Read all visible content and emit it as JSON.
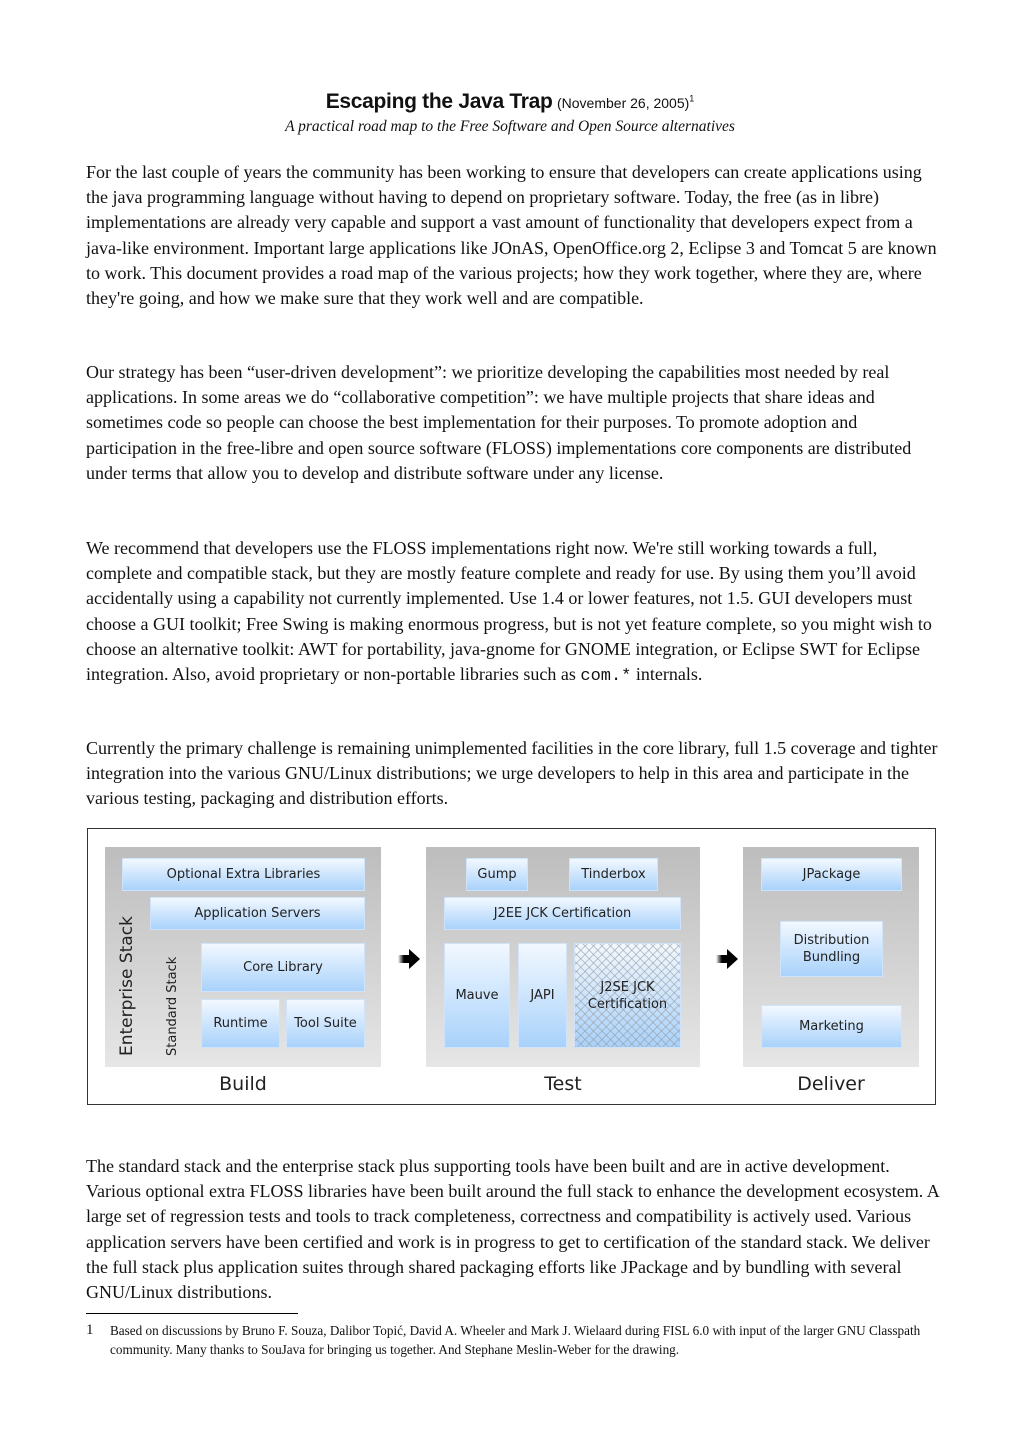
{
  "header": {
    "title": "Escaping the Java Trap",
    "date": "(November 26, 2005)",
    "footnote_ref": "1",
    "subtitle": "A practical road map to the Free Software and Open Source alternatives"
  },
  "paragraphs": [
    "For the last couple of years the community has been working to ensure that developers can create applications using the java programming language without having to depend on proprietary software. Today, the free (as in libre) implementations are already very capable and support a vast amount of functionality that developers expect from a java-like environment. Important large applications like JOnAS, OpenOffice.org 2, Eclipse 3 and Tomcat 5 are known to work. This document provides a road map of the various projects; how they work together, where they are, where they're going, and how we make sure that they work well and are compatible.",
    "Our strategy has been “user-driven development”: we prioritize developing the capabilities most needed by real applications. In some areas we do “collaborative competition”: we have multiple projects that share ideas and sometimes code so people can choose the best implementation for their purposes.  To promote adoption and participation in the free-libre and open source software (FLOSS) implementations core components are distributed under terms that allow you to develop and distribute software under any license.",
    "Currently the primary challenge is remaining unimplemented facilities in the core library, full 1.5 coverage and tighter integration into the various GNU/Linux distributions; we urge developers to help in this area and participate in the various testing, packaging and distribution efforts.",
    "The standard stack and the enterprise stack plus supporting tools have been built and are in active development. Various optional extra FLOSS libraries have been built around the full stack to enhance the development ecosystem. A large set of regression tests and tools to track completeness, correctness and compatibility is actively used. Various application servers have been certified and work is in progress to get to certification of the standard stack. We deliver the full stack plus application suites through shared packaging efforts like JPackage and by bundling with several GNU/Linux distributions."
  ],
  "paragraph3": {
    "before_code": "We recommend that developers use the FLOSS implementations right now. We're still working towards a full, complete and compatible stack, but they are mostly feature complete and ready for use. By using them you’ll avoid accidentally using a capability not currently implemented.  Use 1.4 or lower features, not 1.5. GUI developers must choose a GUI toolkit; Free Swing is making enormous progress, but is not yet feature complete, so you might wish to choose an alternative toolkit: AWT for portability, java-gnome for GNOME integration, or Eclipse SWT for Eclipse integration. Also, avoid proprietary or non-portable libraries such as ",
    "code": "com.*",
    "after_code": " internals."
  },
  "diagram": {
    "build": {
      "label": "Build",
      "enterprise_stack": "Enterprise Stack",
      "standard_stack": "Standard Stack",
      "blocks": [
        "Optional Extra Libraries",
        "Application Servers",
        "Core Library",
        "Runtime",
        "Tool Suite"
      ]
    },
    "test": {
      "label": "Test",
      "blocks": [
        "Gump",
        "Tinderbox",
        "J2EE JCK Certification",
        "Mauve",
        "JAPI",
        "J2SE JCK Certification"
      ]
    },
    "deliver": {
      "label": "Deliver",
      "blocks": [
        "JPackage",
        "Distribution Bundling",
        "Marketing"
      ]
    },
    "colors": {
      "block_top": "#f2f8ff",
      "block_bottom": "#a9d2fb",
      "panel_top": "#bdbdbd",
      "panel_bottom": "#e6e6e6"
    }
  },
  "footnote": {
    "number": "1",
    "text": "Based on discussions by Bruno F. Souza, Dalibor Topić, David A. Wheeler and Mark J. Wielaard during FISL 6.0 with input of the larger GNU Classpath community. Many thanks to SouJava for bringing us together. And Stephane Meslin-Weber for the drawing."
  }
}
